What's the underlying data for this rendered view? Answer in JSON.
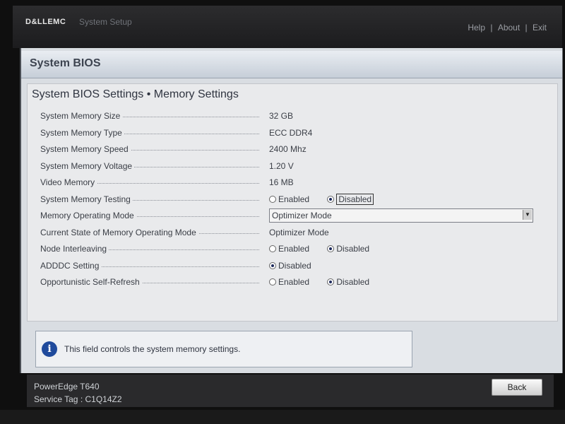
{
  "header": {
    "logo": "D&LLEMC",
    "title": "System Setup",
    "links": [
      "Help",
      "About",
      "Exit"
    ],
    "sep": "|"
  },
  "window": {
    "title": "System BIOS"
  },
  "page": {
    "subtitle": "System BIOS Settings • Memory Settings",
    "rows": [
      {
        "label": "System Memory Size",
        "value": "32 GB"
      },
      {
        "label": "System Memory Type",
        "value": "ECC DDR4"
      },
      {
        "label": "System Memory Speed",
        "value": "2400 Mhz"
      },
      {
        "label": "System Memory Voltage",
        "value": "1.20 V"
      },
      {
        "label": "Video Memory",
        "value": "16 MB"
      },
      {
        "label": "System Memory Testing",
        "enabled": "Enabled",
        "disabled": "Disabled",
        "selected": "Disabled"
      },
      {
        "label": "Memory Operating Mode",
        "value": "Optimizer Mode"
      },
      {
        "label": "Current State of Memory Operating Mode",
        "value": "Optimizer Mode"
      },
      {
        "label": "Node Interleaving",
        "enabled": "Enabled",
        "disabled": "Disabled",
        "selected": "Disabled"
      },
      {
        "label": "ADDDC Setting",
        "disabled": "Disabled",
        "selected": "Disabled"
      },
      {
        "label": "Opportunistic Self-Refresh",
        "enabled": "Enabled",
        "disabled": "Disabled",
        "selected": "Disabled"
      }
    ]
  },
  "help": {
    "text": "This field controls the system memory settings."
  },
  "footer": {
    "model": "PowerEdge T640",
    "service_tag": "Service Tag : C1Q14Z2",
    "back_label": "Back"
  }
}
